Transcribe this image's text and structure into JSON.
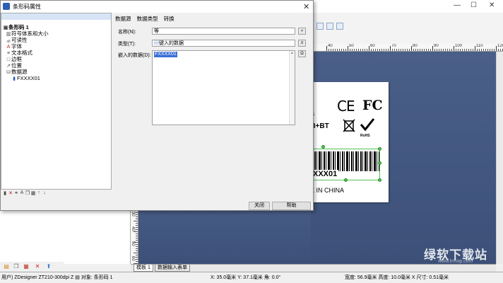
{
  "dialog": {
    "title": "条形码属性",
    "close_glyph": "✕",
    "tree": {
      "root": "条形码 1",
      "items": [
        {
          "icon": "barcode-size-icon",
          "glyph": "▥",
          "label": "符号体系和大小"
        },
        {
          "icon": "readability-icon",
          "glyph": "ₐᵦ",
          "label": "可读性"
        },
        {
          "icon": "font-icon",
          "glyph": "A",
          "label": "字体"
        },
        {
          "icon": "text-format-icon",
          "glyph": "≡",
          "label": "文本格式"
        },
        {
          "icon": "border-icon",
          "glyph": "□",
          "label": "边框"
        },
        {
          "icon": "position-icon",
          "glyph": "↗",
          "label": "位置"
        },
        {
          "icon": "datasource-icon",
          "glyph": "⛁",
          "label": "数据源"
        }
      ],
      "subitem": {
        "icon": "data-item-icon",
        "glyph": "▮",
        "label": "FXXXX01"
      }
    },
    "tabs": [
      "数据源",
      "数据类型",
      "转换"
    ],
    "fields": {
      "name_label": "名称(N):",
      "name_value": "等",
      "type_label": "类型(T):",
      "type_value": "键入的数据",
      "data_label": "嵌入的数据(D):",
      "data_value": "FXXXX01"
    },
    "buttons": {
      "close": "关闭",
      "help": "帮助"
    }
  },
  "label_preview": {
    "ce": "CE",
    "fc": "FC",
    "bt_text": "3+BT",
    "s_text": "S",
    "rohs": "RoHS",
    "barcode_text": "XXX01",
    "country": "E IN CHINA"
  },
  "ruler": {
    "h_numbers": [
      "40",
      "50",
      "60",
      "70",
      "80",
      "90",
      "100",
      "110",
      "120"
    ],
    "v_numbers": [
      "30",
      "40",
      "50",
      "60"
    ]
  },
  "bottom_tabs": [
    "模板 1",
    "数据输入表单"
  ],
  "status": {
    "app": "用户) ZDesigner ZT210-300dpi Z ▤ 对象: 条形码 1",
    "pos": "X: 35.0毫米  Y: 37.1毫米  角: 0.0°",
    "size": "宽度: 56.9毫米  高度: 10.0毫米  X 尺寸: 0.51毫米"
  },
  "watermark": {
    "text": "绿软下载站",
    "url": "www.lrmop.com"
  },
  "window_controls": [
    "—",
    "☐",
    "✕"
  ]
}
